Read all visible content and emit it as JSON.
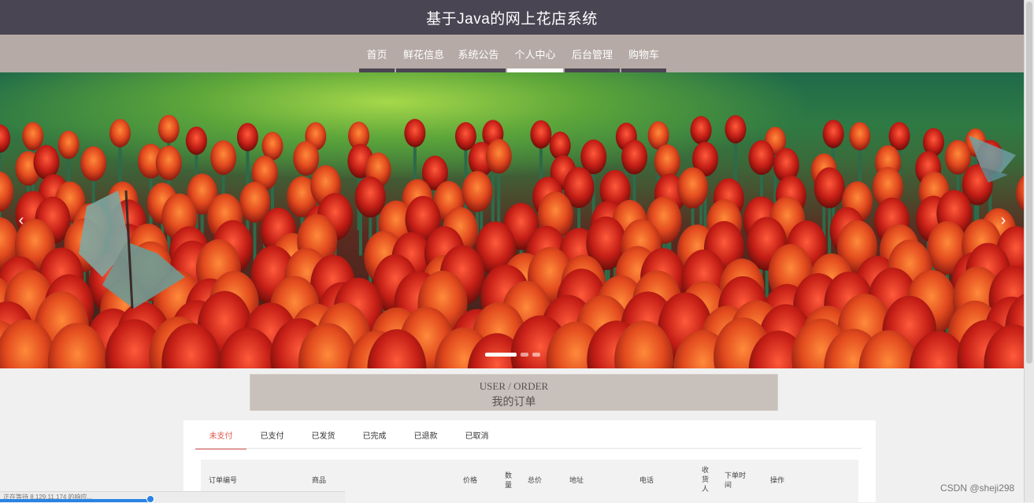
{
  "header": {
    "title": "基于Java的网上花店系统"
  },
  "nav": {
    "items": [
      {
        "label": "首页",
        "active": false
      },
      {
        "label": "鲜花信息",
        "active": false
      },
      {
        "label": "系统公告",
        "active": false
      },
      {
        "label": "个人中心",
        "active": true
      },
      {
        "label": "后台管理",
        "active": false
      },
      {
        "label": "购物车",
        "active": false
      }
    ]
  },
  "carousel": {
    "prev_icon": "‹",
    "next_icon": "›",
    "slide_count": 3,
    "active_slide": 1,
    "image_subject": "red and orange tulip field with butterflies"
  },
  "section": {
    "title_en": "USER / ORDER",
    "title_zh": "我的订单"
  },
  "orders": {
    "tabs": [
      {
        "label": "未支付",
        "active": true
      },
      {
        "label": "已支付",
        "active": false
      },
      {
        "label": "已发货",
        "active": false
      },
      {
        "label": "已完成",
        "active": false
      },
      {
        "label": "已退款",
        "active": false
      },
      {
        "label": "已取消",
        "active": false
      }
    ],
    "columns": [
      "订单编号",
      "商品",
      "价格",
      "数量",
      "总价",
      "地址",
      "电话",
      "收货人",
      "下单时间",
      "操作"
    ]
  },
  "statusbar": {
    "text": "正在等待 8.129.11.174 的响应..."
  },
  "watermark": {
    "text": "CSDN @sheji298"
  },
  "colors": {
    "titlebar": "#4a4552",
    "navbar": "#b5aaa5",
    "accent": "#d9534f"
  }
}
